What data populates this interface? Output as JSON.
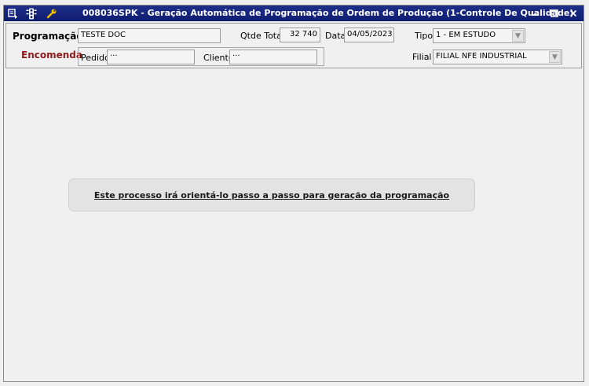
{
  "window": {
    "title": "008036SPK - Geração Automática de Programação de Ordem de Produção (1-Controle De Qualidade)",
    "minimize": "▬",
    "maximize": "■",
    "close": "✕"
  },
  "header": {
    "programacao_label": "Programação",
    "programacao_value": "TESTE DOC",
    "qtde_total_label": "Qtde Total",
    "qtde_total_value": "32 740",
    "data_label": "Data",
    "data_value": "04/05/2023",
    "tipo_label": "Tipo",
    "tipo_value": "1 - EM ESTUDO",
    "encomenda_label": "Encomenda",
    "pedido_label": "Pedido",
    "pedido_value": "···",
    "cliente_label": "Cliente",
    "cliente_value": "···",
    "filial_label": "Filial",
    "filial_value": "FILIAL NFE INDUSTRIAL"
  },
  "main": {
    "info_text": "Este processo irá orientá-lo passo a passo para geração da programação"
  },
  "icons": {
    "menu": "menu-icon",
    "traffic_light": "traffic-light-icon",
    "wrench": "wrench-icon"
  },
  "colors": {
    "titlebar": "#1a2a80",
    "encomenda": "#8b1a1a"
  }
}
